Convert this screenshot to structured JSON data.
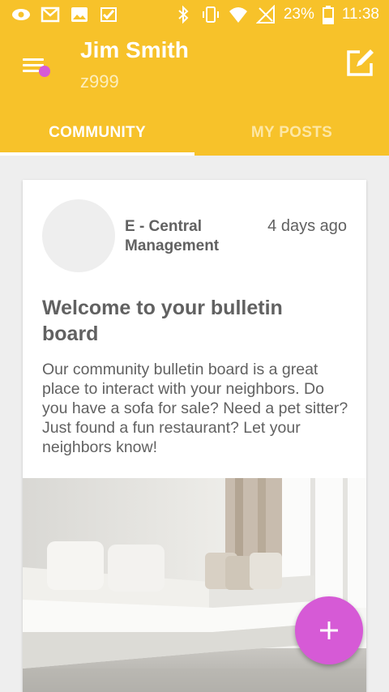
{
  "status_bar": {
    "battery": "23%",
    "time": "11:38",
    "left_icons": [
      "eye-icon",
      "gmail-icon",
      "image-icon",
      "check-icon"
    ],
    "right_icons": [
      "bluetooth-icon",
      "vibrate-icon",
      "wifi-icon",
      "no-signal-icon",
      "battery-icon"
    ]
  },
  "header": {
    "user_name": "Jim Smith",
    "user_id": "z999"
  },
  "tabs": [
    {
      "label": "COMMUNITY",
      "active": true
    },
    {
      "label": "MY POSTS",
      "active": false
    }
  ],
  "post": {
    "author": "E - Central Management",
    "time_ago": "4 days ago",
    "title": "Welcome to your bulletin board",
    "body": "Our community bulletin board is a great place to interact with your neighbors.  Do you have a sofa for sale?  Need a pet sitter?  Just found a fun restaurant?  Let your neighbors know!"
  },
  "colors": {
    "primary": "#f7c22a",
    "accent": "#d65ad6",
    "text": "#616161",
    "background": "#eeeeee"
  }
}
